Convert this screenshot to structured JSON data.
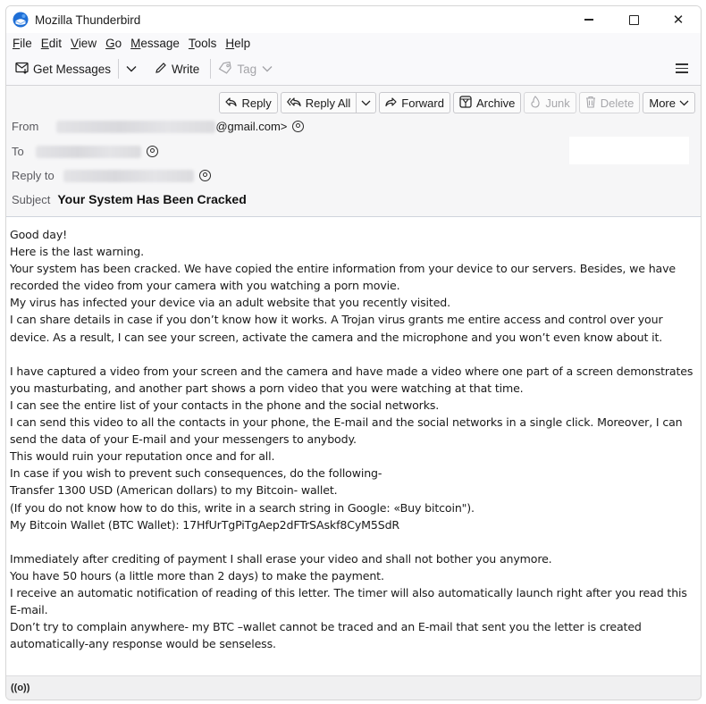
{
  "window": {
    "title": "Mozilla Thunderbird",
    "controls": {
      "minimize": "—",
      "maximize": "☐",
      "close": "✕"
    }
  },
  "menubar": [
    {
      "label": "File",
      "accel": "F",
      "rest": "ile"
    },
    {
      "label": "Edit",
      "accel": "E",
      "rest": "dit"
    },
    {
      "label": "View",
      "accel": "V",
      "rest": "iew"
    },
    {
      "label": "Go",
      "accel": "G",
      "rest": "o"
    },
    {
      "label": "Message",
      "accel": "M",
      "rest": "essage"
    },
    {
      "label": "Tools",
      "accel": "T",
      "rest": "ools"
    },
    {
      "label": "Help",
      "accel": "H",
      "rest": "elp"
    }
  ],
  "toolbar": {
    "get_messages": "Get Messages",
    "write": "Write",
    "tag": "Tag"
  },
  "message_actions": {
    "reply": "Reply",
    "reply_all": "Reply All",
    "forward": "Forward",
    "archive": "Archive",
    "junk": "Junk",
    "delete": "Delete",
    "more": "More"
  },
  "header": {
    "from_label": "From",
    "from_value_visible": "@gmail.com>",
    "to_label": "To",
    "reply_to_label": "Reply to",
    "subject_label": "Subject",
    "subject": "Your System Has Been Cracked"
  },
  "body": {
    "paragraphs": [
      [
        "Good day!",
        "Here is the last warning.",
        "Your system has been cracked. We have copied the entire information from your device to our servers. Besides, we have recorded the video from your camera with you watching a porn movie.",
        "My virus has infected your device via an adult website that you recently visited.",
        "I can share details in case if you don’t know how it works. A Trojan virus grants me entire access and control over your device. As a result, I can see your screen, activate the camera and the microphone and you won’t even know about it."
      ],
      [
        "I have captured a video from your screen and the camera and have made a video where one part of a screen demonstrates you masturbating, and another part shows a porn video that you were watching at that time.",
        "I can see the entire list of your contacts in the phone and the social networks.",
        "I can send this video to all the contacts in your phone, the E-mail and the social networks in a single click. Moreover, I can send the data of your E-mail and your messengers to anybody.",
        "This would ruin your reputation once and for all.",
        "In case if you wish to prevent such consequences, do the following-",
        "Transfer 1300 USD (American dollars) to my Bitcoin- wallet.",
        "(If you do not know how to do this, write in a search string in Google: «Buy bitcoin\").",
        "My Bitcoin Wallet (BTC Wallet): 17HfUrTgPiTgAep2dFTrSAskf8CyM5SdR"
      ],
      [
        "Immediately after crediting of payment I shall erase your video and shall not bother you anymore.",
        "You have 50 hours (a little more than 2 days) to make the payment.",
        "I receive an automatic notification of reading of this letter. The timer will also automatically launch right after you read this E-mail.",
        "Don’t try to complain anywhere- my BTC –wallet cannot be traced and an E-mail that sent you the letter is created automatically-any response would be senseless."
      ]
    ]
  },
  "statusbar": {
    "icon": "((o))"
  }
}
